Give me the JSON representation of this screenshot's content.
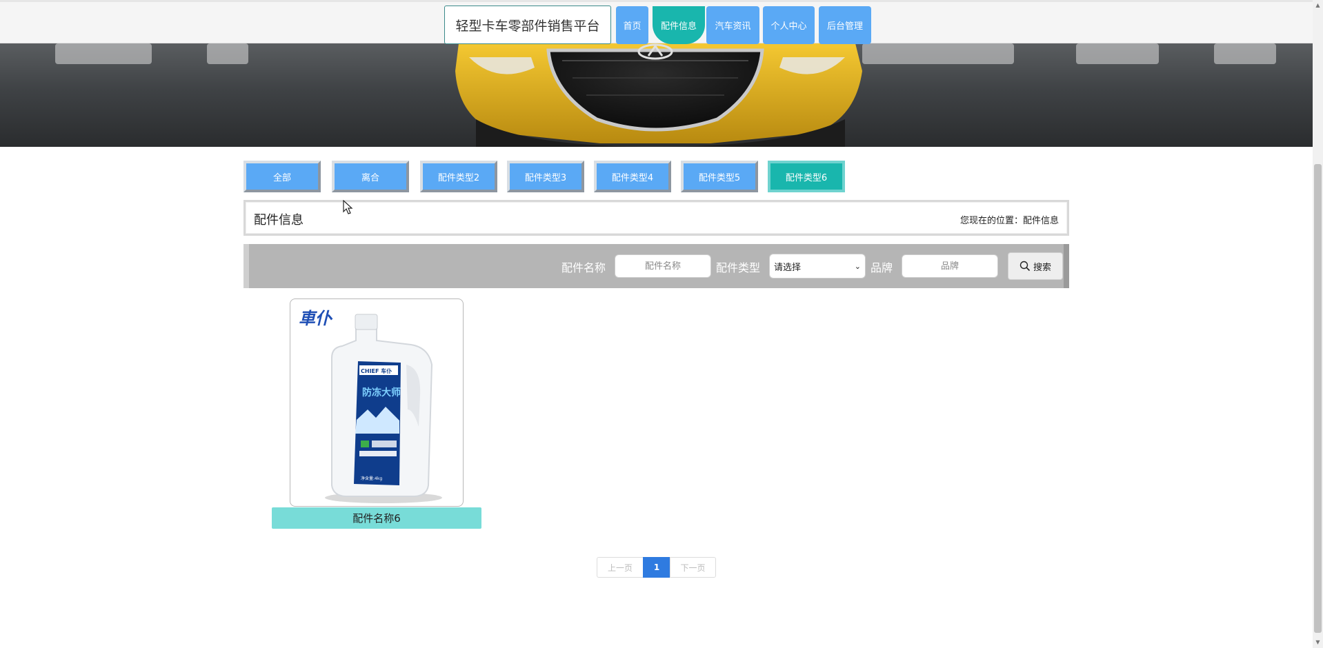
{
  "site": {
    "title": "轻型卡车零部件销售平台"
  },
  "nav": {
    "items": [
      {
        "label": "首页"
      },
      {
        "label": "配件信息"
      },
      {
        "label": "汽车资讯"
      },
      {
        "label": "个人中心"
      },
      {
        "label": "后台管理"
      }
    ],
    "active_index": 1
  },
  "categories": {
    "items": [
      {
        "label": "全部"
      },
      {
        "label": "离合"
      },
      {
        "label": "配件类型2"
      },
      {
        "label": "配件类型3"
      },
      {
        "label": "配件类型4"
      },
      {
        "label": "配件类型5"
      },
      {
        "label": "配件类型6"
      }
    ],
    "active_index": 6
  },
  "header": {
    "title": "配件信息",
    "location_prefix": "您现在的位置：",
    "location_value": "配件信息"
  },
  "search": {
    "name_label": "配件名称",
    "name_placeholder": "配件名称",
    "type_label": "配件类型",
    "type_selected": "请选择",
    "brand_label": "品牌",
    "brand_placeholder": "品牌",
    "button_label": "搜索"
  },
  "products": [
    {
      "name": "配件名称6",
      "image": {
        "logo_text": "車仆",
        "label_text": "防冻大师",
        "brand_text": "CHIEF 车仆",
        "net_text": "净含量:4kg"
      }
    }
  ],
  "pagination": {
    "prev": "上一页",
    "current": "1",
    "next": "下一页"
  },
  "colors": {
    "nav_blue": "#5aa9f5",
    "active_teal": "#19b6ad",
    "card_label": "#78dcd8",
    "page_current": "#2f7be0"
  }
}
